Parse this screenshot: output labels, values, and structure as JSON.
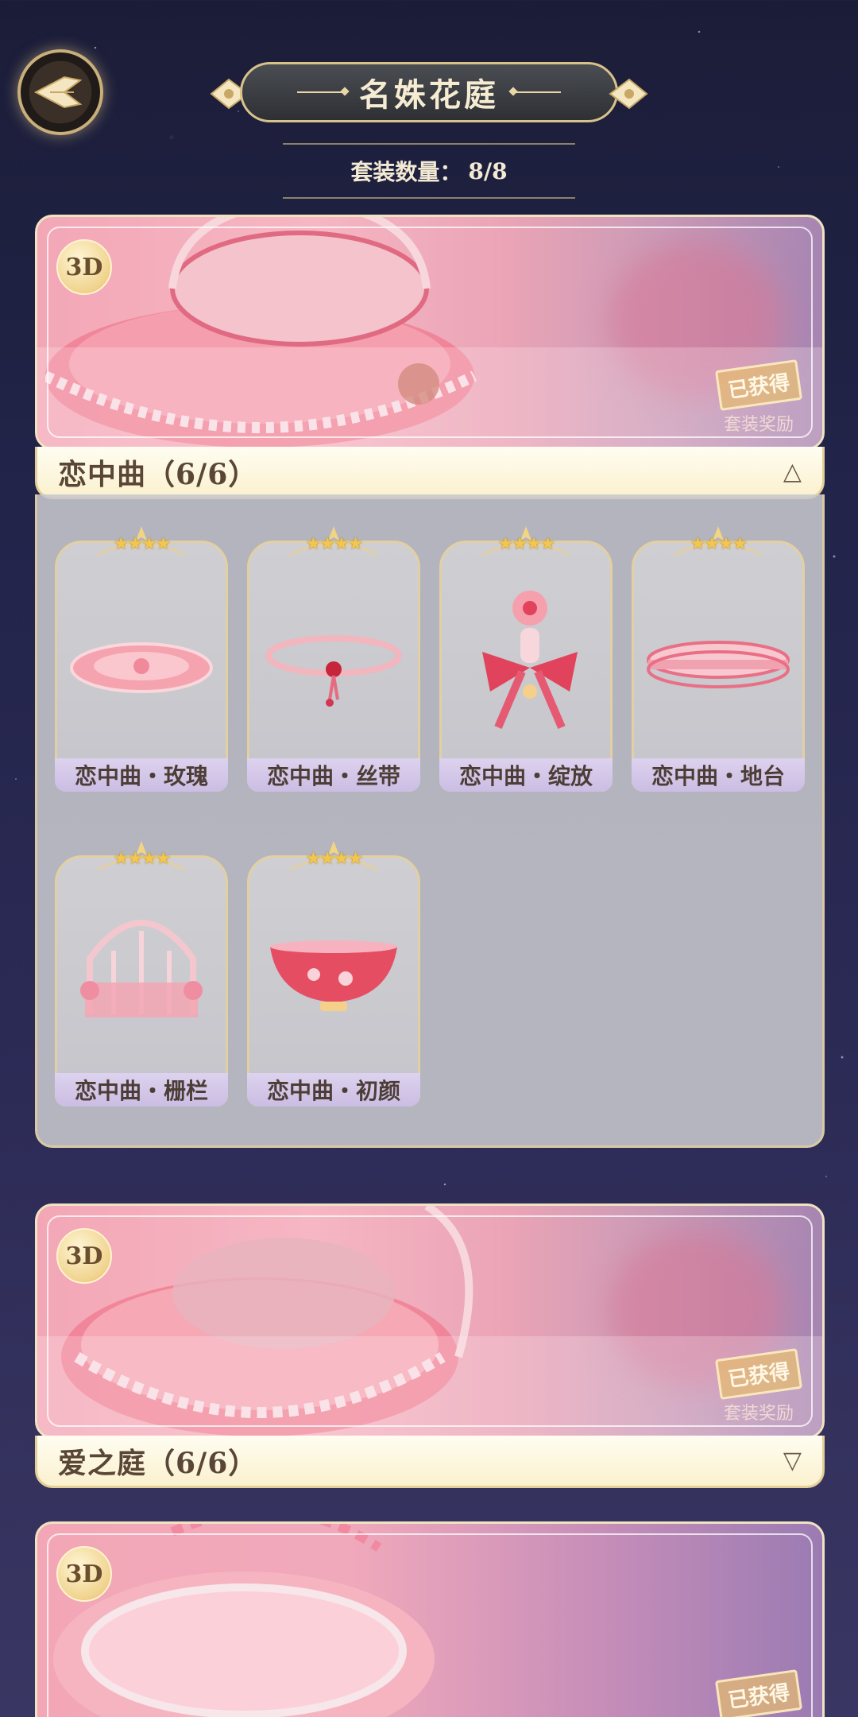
{
  "header": {
    "title": "名姝花庭",
    "count_label": "套装数量：",
    "count_value": "8/8"
  },
  "suits": [
    {
      "name": "恋中曲（6/6）",
      "expanded": true,
      "badge": "3D",
      "obtained": "已获得",
      "reward_label": "套装奖励",
      "arrow": "△",
      "items": [
        {
          "name": "恋中曲・玫瑰",
          "stars": "★★★★",
          "art": "rose-plate"
        },
        {
          "name": "恋中曲・丝带",
          "stars": "★★★★",
          "art": "ribbon-circlet"
        },
        {
          "name": "恋中曲・绽放",
          "stars": "★★★★",
          "art": "blossom-bow"
        },
        {
          "name": "恋中曲・地台",
          "stars": "★★★★",
          "art": "stage-platform"
        },
        {
          "name": "恋中曲・栅栏",
          "stars": "★★★★",
          "art": "fence-arch"
        },
        {
          "name": "恋中曲・初颜",
          "stars": "★★★★",
          "art": "flower-bowl"
        }
      ]
    },
    {
      "name": "爱之庭（6/6）",
      "expanded": false,
      "badge": "3D",
      "obtained": "已获得",
      "reward_label": "套装奖励",
      "arrow": "▽"
    },
    {
      "badge": "3D",
      "obtained": "已获得"
    }
  ],
  "colors": {
    "background": "#22244a",
    "gold": "#d8c28a",
    "label_bar": "#fbf1cf",
    "caption": "#cbbde3"
  }
}
